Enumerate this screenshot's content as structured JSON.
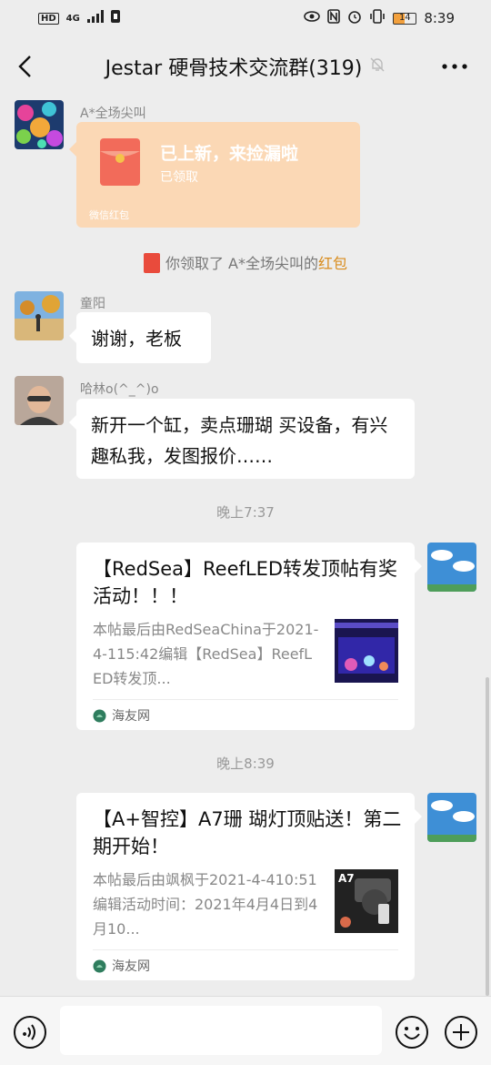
{
  "status": {
    "hd": "HD",
    "network": "4G",
    "battery": "14",
    "time": "8:39"
  },
  "header": {
    "title": "Jestar 硬骨技术交流群(319)"
  },
  "messages": {
    "m1": {
      "sender": "A*全场尖叫",
      "rp_title": "已上新，来捡漏啦",
      "rp_status": "已领取",
      "rp_footer": "微信红包"
    },
    "sys": {
      "text": "你领取了 A*全场尖叫的",
      "link": "红包"
    },
    "m2": {
      "sender": "童阳",
      "text": "谢谢，老板"
    },
    "m3": {
      "sender": "哈林o(^_^)o",
      "text": "新开一个缸，卖点珊瑚 买设备，有兴趣私我，发图报价……"
    },
    "time1": "晚上7:37",
    "card1": {
      "title": "【RedSea】ReefLED转发顶帖有奖活动！！！",
      "desc": "本帖最后由RedSeaChina于2021-4-115:42编辑【RedSea】ReefLED转发顶...",
      "source": "海友网"
    },
    "time2": "晚上8:39",
    "card2": {
      "title": "【A+智控】A7珊 瑚灯顶贴送！第二期开始！",
      "desc": "本帖最后由飒枫于2021-4-410:51编辑活动时间：2021年4月4日到4月10...",
      "source": "海友网",
      "thumb_label": "A7"
    }
  },
  "colors": {
    "link": "#d98c1d",
    "redpacket": "#fbd8b5"
  }
}
